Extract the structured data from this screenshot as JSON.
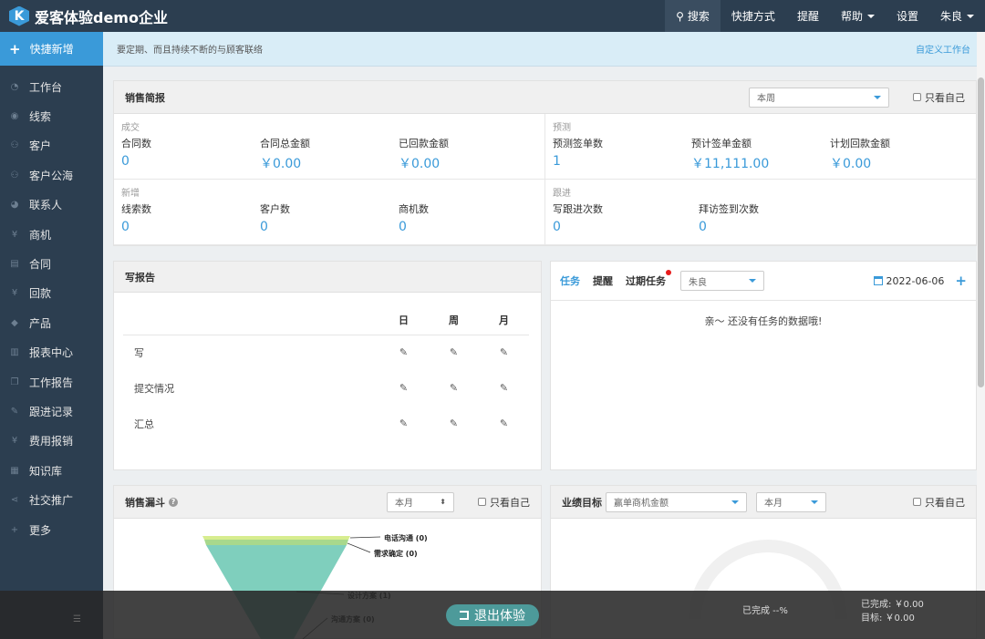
{
  "app": {
    "logo_letter": "K",
    "title": "爱客体验demo企业"
  },
  "topnav": {
    "search": "搜索",
    "shortcuts": "快捷方式",
    "reminder": "提醒",
    "help": "帮助",
    "settings": "设置",
    "user": "朱良"
  },
  "sidebar": {
    "quick_add": "快捷新增",
    "items": [
      {
        "label": "工作台",
        "icon": "dashboard-icon"
      },
      {
        "label": "线索",
        "icon": "target-icon"
      },
      {
        "label": "客户",
        "icon": "users-icon"
      },
      {
        "label": "客户公海",
        "icon": "users-icon"
      },
      {
        "label": "联系人",
        "icon": "comments-icon"
      },
      {
        "label": "商机",
        "icon": "yen-icon"
      },
      {
        "label": "合同",
        "icon": "file-icon"
      },
      {
        "label": "回款",
        "icon": "yen-icon"
      },
      {
        "label": "产品",
        "icon": "tag-icon"
      },
      {
        "label": "报表中心",
        "icon": "bar-chart-icon"
      },
      {
        "label": "工作报告",
        "icon": "copy-icon"
      },
      {
        "label": "跟进记录",
        "icon": "edit-icon"
      },
      {
        "label": "费用报销",
        "icon": "yen-icon"
      },
      {
        "label": "知识库",
        "icon": "book-icon"
      },
      {
        "label": "社交推广",
        "icon": "share-icon"
      },
      {
        "label": "更多",
        "icon": "plus-icon"
      }
    ]
  },
  "notice": {
    "text": "要定期、而且持续不断的与顾客联络",
    "custom_link": "自定义工作台"
  },
  "sales_brief": {
    "title": "销售简报",
    "period": "本周",
    "only_me": "只看自己",
    "blocks": [
      {
        "caption": "成交",
        "cells": [
          {
            "label": "合同数",
            "value": "0"
          },
          {
            "label": "合同总金额",
            "value": "￥0.00"
          },
          {
            "label": "已回款金额",
            "value": "￥0.00"
          }
        ]
      },
      {
        "caption": "预测",
        "cells": [
          {
            "label": "预测签单数",
            "value": "1"
          },
          {
            "label": "预计签单金额",
            "value": "￥11,111.00"
          },
          {
            "label": "计划回款金额",
            "value": "￥0.00"
          }
        ]
      },
      {
        "caption": "新增",
        "cells": [
          {
            "label": "线索数",
            "value": "0"
          },
          {
            "label": "客户数",
            "value": "0"
          },
          {
            "label": "商机数",
            "value": "0"
          }
        ]
      },
      {
        "caption": "跟进",
        "cells": [
          {
            "label": "写跟进次数",
            "value": "0"
          },
          {
            "label": "拜访签到次数",
            "value": "0"
          }
        ]
      }
    ]
  },
  "report": {
    "title": "写报告",
    "cols": [
      "日",
      "周",
      "月"
    ],
    "rows": [
      "写",
      "提交情况",
      "汇总"
    ]
  },
  "tasks": {
    "tab_task": "任务",
    "tab_reminder": "提醒",
    "tab_overdue": "过期任务",
    "user": "朱良",
    "date": "2022-06-06",
    "empty": "亲～ 还没有任务的数据哦!"
  },
  "funnel": {
    "title": "销售漏斗",
    "period": "本月",
    "only_me": "只看自己",
    "stages": [
      {
        "label": "电话沟通 (0)"
      },
      {
        "label": "需求确定 (0)"
      },
      {
        "label": "设计方案 (1)"
      },
      {
        "label": "沟通方案 (0)"
      }
    ],
    "colors": [
      "#d7ed8f",
      "#a8d88c",
      "#7fcfbd"
    ]
  },
  "target": {
    "title": "业绩目标",
    "metric": "赢单商机金额",
    "period": "本月",
    "only_me": "只看自己",
    "done_pct": "已完成 --%",
    "done_amount": "已完成:  ￥0.00",
    "target_amount": "目标:  ￥0.00"
  },
  "exit": {
    "label": "退出体验"
  }
}
